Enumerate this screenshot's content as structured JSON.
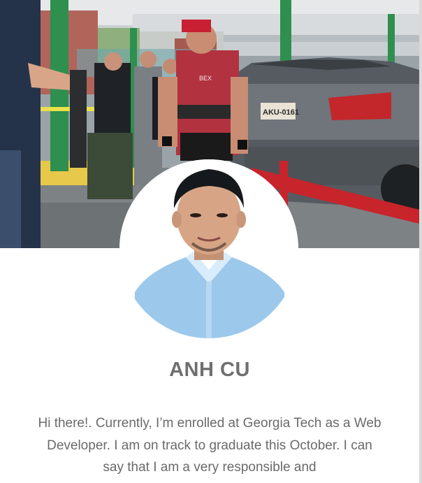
{
  "profile": {
    "name": "ANH CU",
    "bio": "Hi there!. Currently, I’m enrolled at Georgia Tech as a Web Developer. I am on track to graduate this October. I can say that I am a very responsible and"
  },
  "cover_photo": {
    "license_plate": "AKU-0161",
    "shirt_logo": "BEX"
  },
  "colors": {
    "name_text": "#6f6f6f",
    "bio_text": "#6a6a6a",
    "background": "#ffffff"
  }
}
